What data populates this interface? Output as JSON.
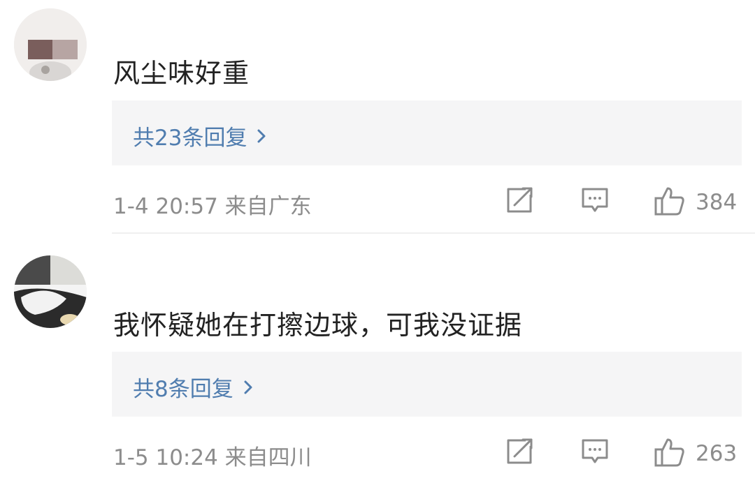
{
  "comments": [
    {
      "text": "风尘味好重",
      "reply_link": "共23条回复",
      "meta": "1-4 20:57 来自广东",
      "likes": "384"
    },
    {
      "text": "我怀疑她在打擦边球，可我没证据",
      "reply_link": "共8条回复",
      "meta": "1-5 10:24 来自四川",
      "likes": "263"
    }
  ],
  "colors": {
    "link": "#507daf",
    "meta": "#8c8c8c",
    "reply_box_bg": "#f5f5f6"
  },
  "icons": [
    "share-icon",
    "comment-icon",
    "like-icon",
    "chevron-right-icon"
  ]
}
